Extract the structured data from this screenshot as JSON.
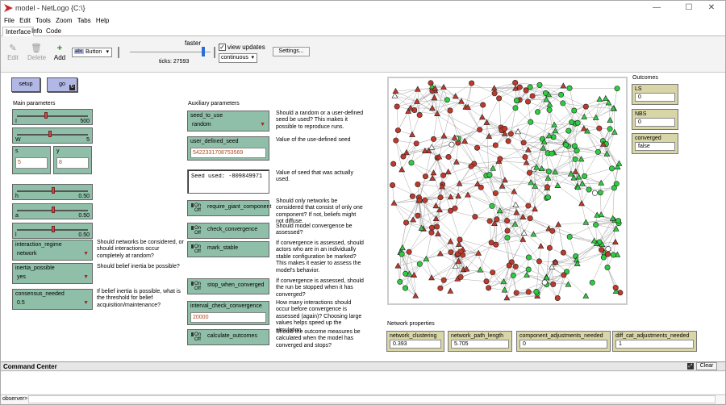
{
  "window": {
    "title": "model - NetLogo {C:\\}",
    "min": "—",
    "max": "☐",
    "close": "✕"
  },
  "menu": [
    "File",
    "Edit",
    "Tools",
    "Zoom",
    "Tabs",
    "Help"
  ],
  "tabs": [
    "Interface",
    "Info",
    "Code"
  ],
  "toolbar": {
    "edit": "Edit",
    "delete": "Delete",
    "add": "Add",
    "widget_type": "Button",
    "faster": "faster",
    "ticks": "ticks: 27593",
    "view_updates": "view updates",
    "update_mode": "continuous",
    "settings": "Settings..."
  },
  "buttons": {
    "setup": "setup",
    "go": "go"
  },
  "headings": {
    "main": "Main parameters",
    "aux": "Auxiliary parameters",
    "outcomes": "Outcomes",
    "network": "Network properties"
  },
  "sliders": [
    {
      "label": "I",
      "value": "500",
      "frac": 0.4
    },
    {
      "label": "W",
      "value": "5",
      "frac": 0.45
    },
    {
      "label": "h",
      "value": "0.50",
      "frac": 0.5
    },
    {
      "label": "a",
      "value": "0.50",
      "frac": 0.5
    },
    {
      "label": "l",
      "value": "0.50",
      "frac": 0.5
    }
  ],
  "inputs_main": [
    {
      "label": "s",
      "value": "5"
    },
    {
      "label": "y",
      "value": "8"
    }
  ],
  "choosers": [
    {
      "label": "interaction_regime",
      "value": "network"
    },
    {
      "label": "inertia_possible",
      "value": "yes"
    },
    {
      "label": "consensus_needed",
      "value": "0.5"
    }
  ],
  "main_notes": [
    "Should networks be considered, or should interactions occur completely at random?",
    "Should belief inertia be possible?",
    "If belief inertia is possible, what is the threshold for belief acquisition/maintenance?"
  ],
  "aux": {
    "seed_chooser": {
      "label": "seed_to_use",
      "value": "random"
    },
    "seed_input": {
      "label": "user_defined_seed",
      "value": "5422331708753569"
    },
    "seed_output": "Seed used: -809849971",
    "switch_on": "On",
    "switch_off": "Off",
    "switches": [
      "require_giant_component",
      "check_convergence",
      "mark_stable",
      "stop_when_converged",
      "calculate_outcomes"
    ],
    "interval": {
      "label": "interval_check_convergence",
      "value": "20000"
    },
    "notes": [
      "Should a random or a user-defined seed be used? This makes it possible to reproduce runs.",
      "Value of the use-defined seed",
      "Value of seed that was actually used.",
      "Should only networks be considered that consist of only one component? If not, beliefs might not diffuse.",
      "Should model convergence be assessed?",
      "If convergence is assessed, should actors who are in an individually stable configuration be marked? This makes it easier to assess the model's behavior.",
      "If convergence is assessed, should the run be stopped when it has converged?",
      "How many interactions should occur before convergence is assessed (again)? Choosing large values helps speed up the simulation.",
      "Should the outcome measures be calculated when the model has converged and stops?"
    ]
  },
  "outcomes": [
    {
      "label": "LS",
      "value": "0"
    },
    {
      "label": "NBS",
      "value": "0"
    },
    {
      "label": "converged",
      "value": "false"
    }
  ],
  "network_props": [
    {
      "label": "network_clustering",
      "value": "0.393"
    },
    {
      "label": "network_path_length",
      "value": "5.705"
    },
    {
      "label": "component_adjustments_needed",
      "value": "0"
    },
    {
      "label": "diff_cat_adjustments_needed",
      "value": "1"
    }
  ],
  "command": {
    "title": "Command Center",
    "clear": "Clear",
    "prompt": "observer>"
  },
  "colors": {
    "red": "#c0392b",
    "green": "#2ecc40",
    "white": "#ffffff",
    "button": "#b2b8e6",
    "widget": "#8fbfa8",
    "monitor": "#d8d5a6"
  }
}
